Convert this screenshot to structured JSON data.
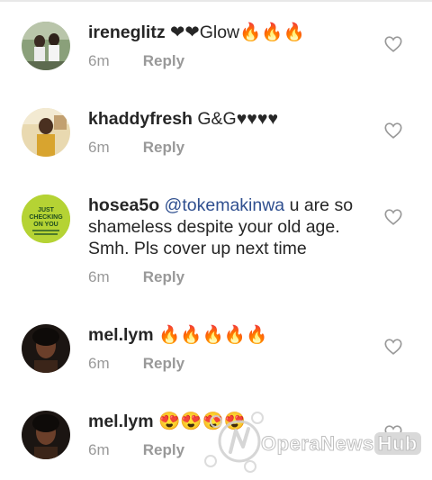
{
  "comments": [
    {
      "username": "ireneglitz",
      "text": "❤❤Glow🔥🔥🔥",
      "time": "6m",
      "reply": "Reply"
    },
    {
      "username": "khaddyfresh",
      "text": "G&G♥♥♥♥",
      "time": "6m",
      "reply": "Reply"
    },
    {
      "username": "hosea5o",
      "mention": "@tokemakinwa",
      "text": "u are so shameless despite your old age. Smh. Pls cover up next time",
      "time": "6m",
      "reply": "Reply",
      "avatar_text": [
        "JUST",
        "CHECKING",
        "ON YOU"
      ]
    },
    {
      "username": "mel.lym",
      "text": "🔥🔥🔥🔥🔥",
      "time": "6m",
      "reply": "Reply"
    },
    {
      "username": "mel.lym",
      "text": "😍😍😍😍",
      "time": "6m",
      "reply": "Reply"
    }
  ],
  "watermark": {
    "brand": "OperaNews",
    "suffix": "Hub"
  },
  "colors": {
    "text": "#262626",
    "meta": "#999999",
    "mention": "#2f4f8f",
    "avatar_green": "#b5d334"
  }
}
